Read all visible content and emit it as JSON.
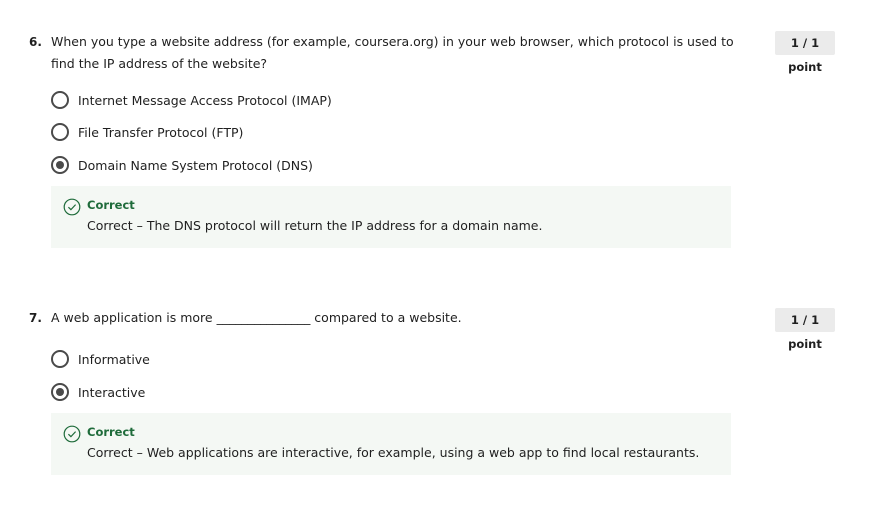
{
  "questions": [
    {
      "number": "6.",
      "text": "When you type a website address (for example, coursera.org) in your web browser, which protocol is used to find the IP address of the website?",
      "points": "1 / 1 point",
      "options": [
        {
          "label": "Internet Message Access Protocol (IMAP)",
          "selected": false
        },
        {
          "label": "File Transfer Protocol (FTP)",
          "selected": false
        },
        {
          "label": "Domain Name System Protocol (DNS)",
          "selected": true
        }
      ],
      "feedback": {
        "title": "Correct",
        "text": "Correct – The DNS protocol will return the IP address for a domain name."
      }
    },
    {
      "number": "7.",
      "text": "A web application is more _______________ compared to a website.",
      "points": "1 / 1 point",
      "options": [
        {
          "label": "Informative",
          "selected": false
        },
        {
          "label": "Interactive",
          "selected": true
        }
      ],
      "feedback": {
        "title": "Correct",
        "text": "Correct – Web applications are interactive, for example, using a web app to find local restaurants."
      }
    }
  ],
  "colors": {
    "correct_green": "#1e6b3a",
    "feedback_bg": "#f4f8f4",
    "badge_bg": "#ebebeb"
  },
  "icons": {
    "correct": "check-circle-icon"
  }
}
